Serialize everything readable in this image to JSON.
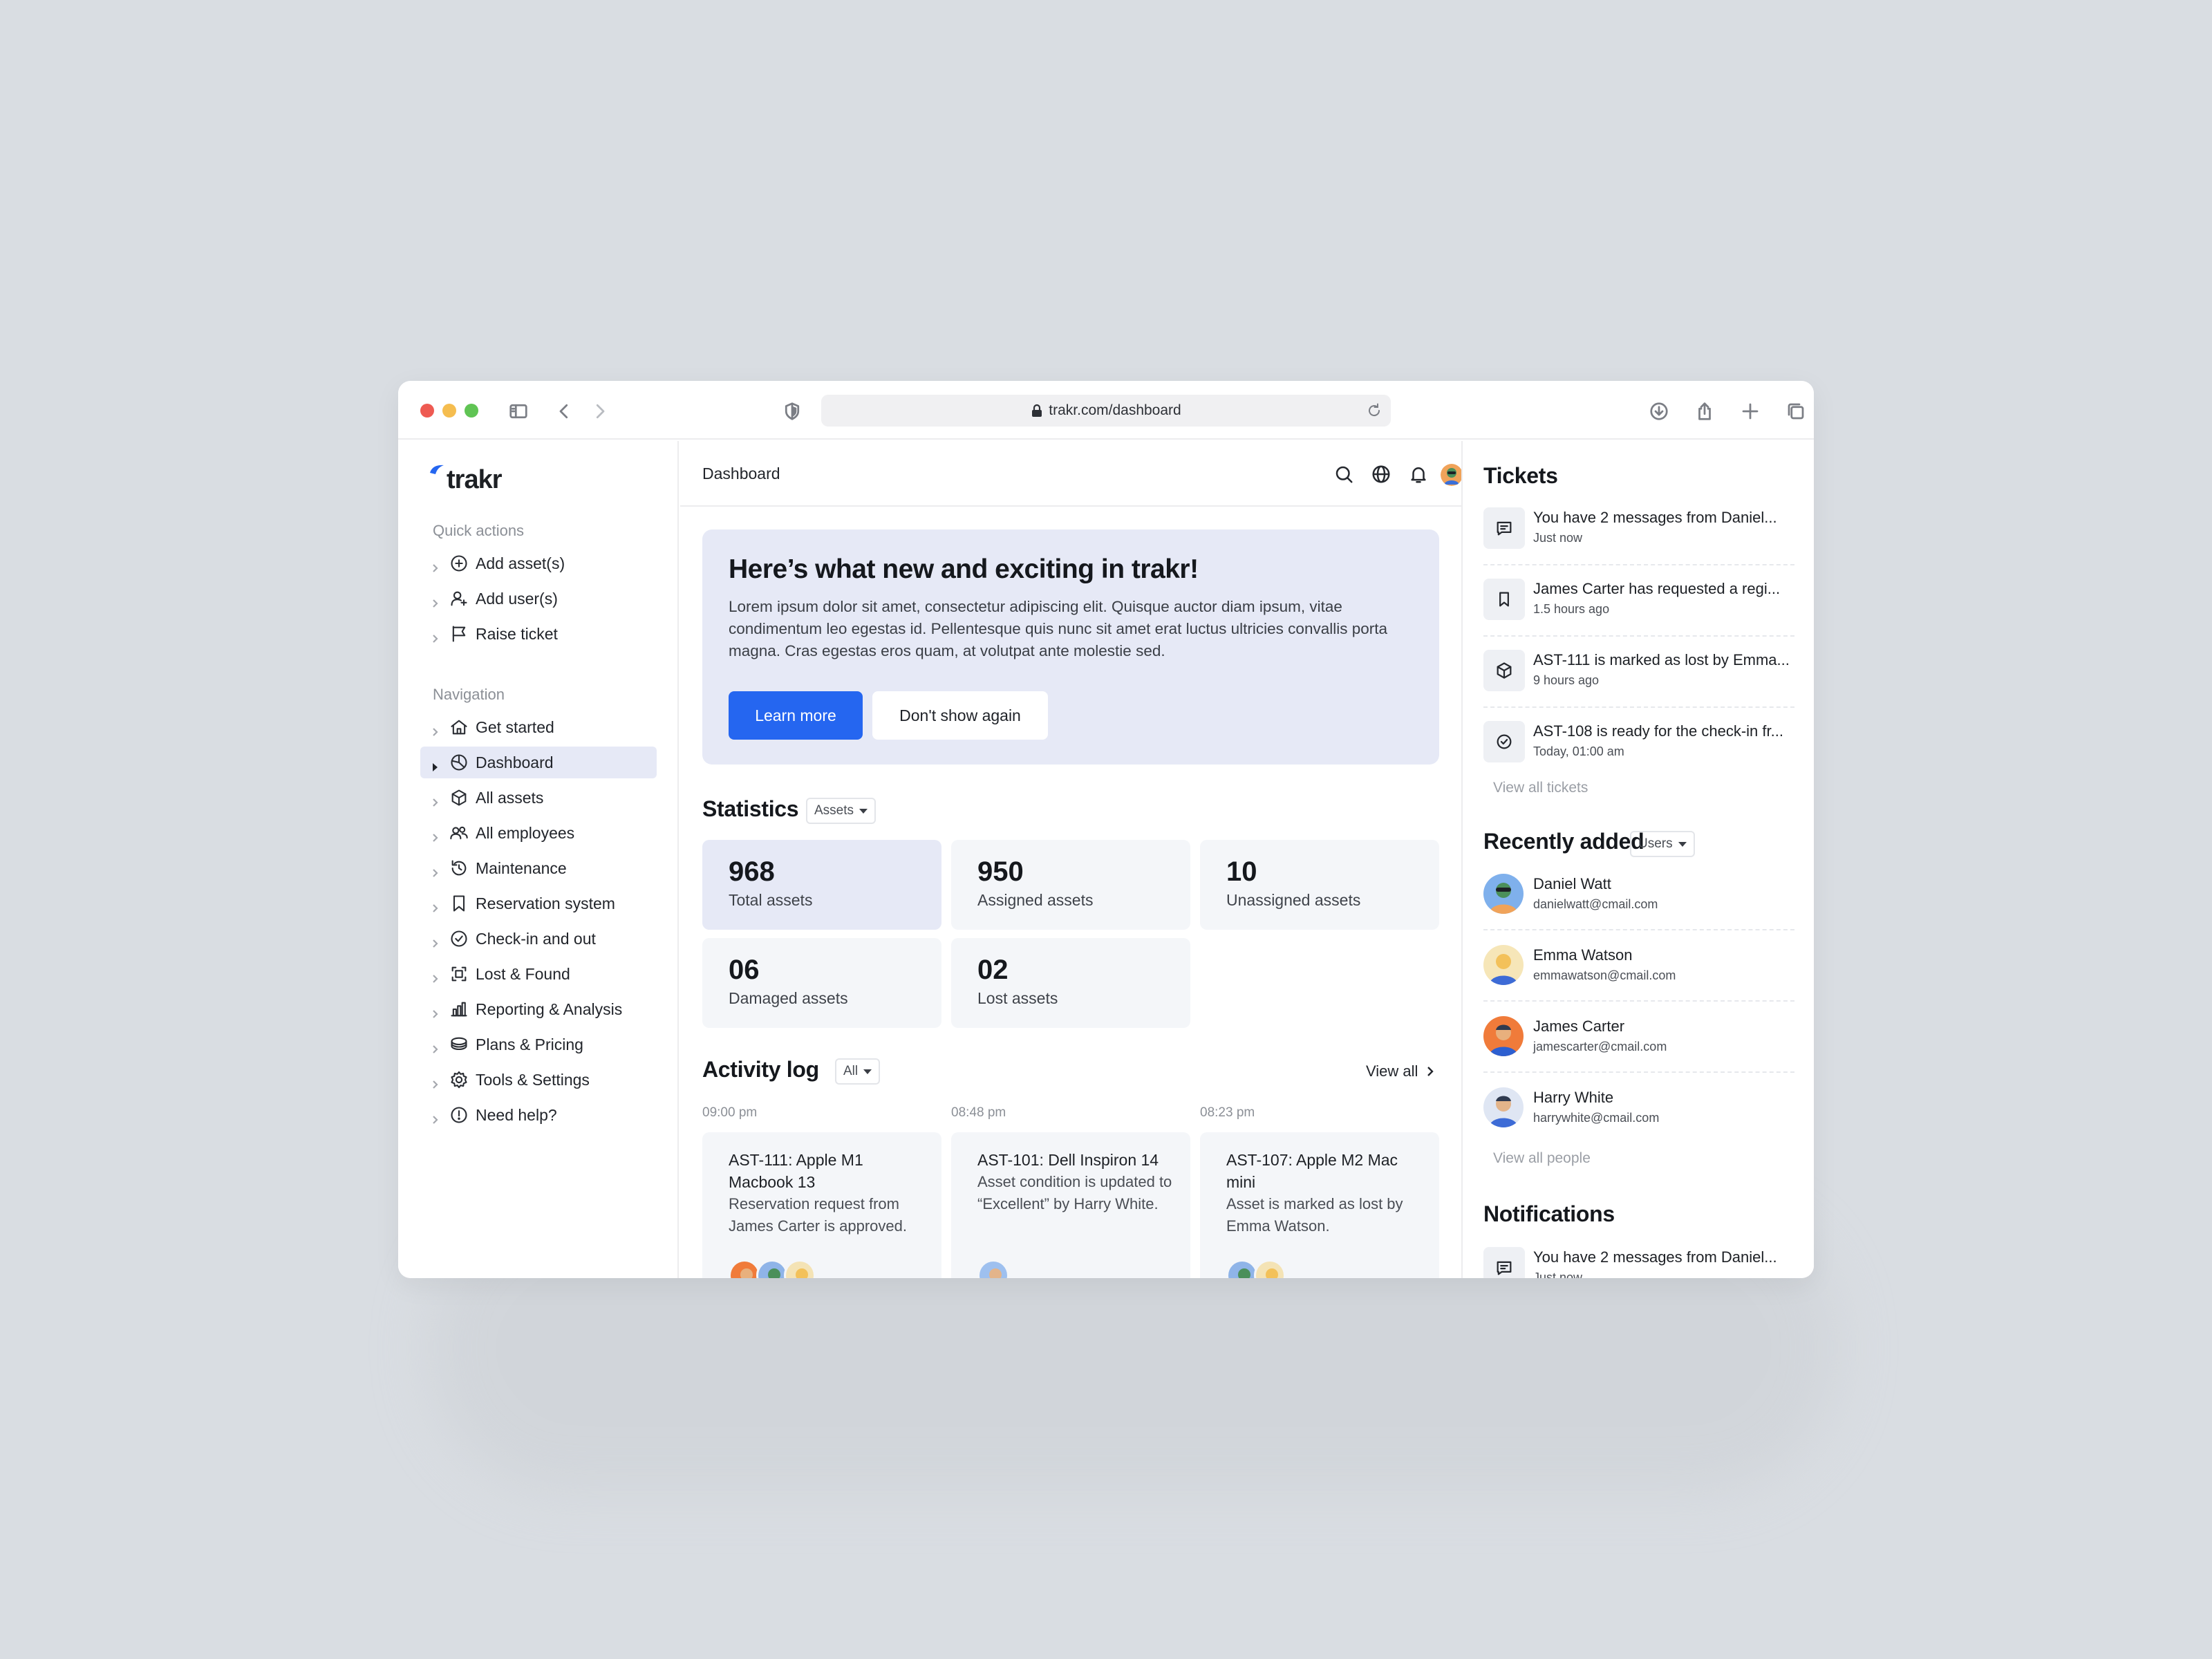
{
  "browser": {
    "url": "trakr.com/dashboard"
  },
  "brand": {
    "name": "trakr",
    "accent": "#2566f0"
  },
  "sidebar": {
    "quick_actions_label": "Quick actions",
    "quick_actions": [
      {
        "label": "Add asset(s)",
        "icon": "plus-circle-icon"
      },
      {
        "label": "Add user(s)",
        "icon": "user-plus-icon"
      },
      {
        "label": "Raise ticket",
        "icon": "flag-icon"
      }
    ],
    "navigation_label": "Navigation",
    "navigation": [
      {
        "label": "Get started",
        "icon": "home-icon"
      },
      {
        "label": "Dashboard",
        "icon": "dashboard-icon",
        "active": true
      },
      {
        "label": "All assets",
        "icon": "box-icon"
      },
      {
        "label": "All employees",
        "icon": "users-icon"
      },
      {
        "label": "Maintenance",
        "icon": "history-icon"
      },
      {
        "label": "Reservation system",
        "icon": "bookmark-icon"
      },
      {
        "label": "Check-in and out",
        "icon": "check-circle-icon"
      },
      {
        "label": "Lost & Found",
        "icon": "scan-icon"
      },
      {
        "label": "Reporting & Analysis",
        "icon": "bar-chart-icon"
      },
      {
        "label": "Plans & Pricing",
        "icon": "coins-icon"
      },
      {
        "label": "Tools & Settings",
        "icon": "gear-icon"
      },
      {
        "label": "Need help?",
        "icon": "alert-circle-icon"
      }
    ]
  },
  "header": {
    "title": "Dashboard"
  },
  "banner": {
    "title": "Here’s what new and exciting in trakr!",
    "body": "Lorem ipsum dolor sit amet, consectetur adipiscing elit. Quisque auctor diam ipsum, vitae condimentum leo egestas id. Pellentesque quis nunc sit amet erat luctus ultricies convallis porta magna. Cras egestas eros quam, at volutpat ante molestie sed.",
    "primary_button": "Learn more",
    "secondary_button": "Don't show again"
  },
  "statistics": {
    "title": "Statistics",
    "filter": "Assets",
    "cards": [
      {
        "value": "968",
        "label": "Total assets"
      },
      {
        "value": "950",
        "label": "Assigned assets"
      },
      {
        "value": "10",
        "label": "Unassigned assets"
      },
      {
        "value": "06",
        "label": "Damaged assets"
      },
      {
        "value": "02",
        "label": "Lost assets"
      }
    ]
  },
  "activity": {
    "title": "Activity log",
    "filter": "All",
    "view_all": "View all",
    "items": [
      {
        "time": "09:00 pm",
        "title": "AST-111: Apple M1 Macbook 13",
        "body": "Reservation request from James Carter is approved."
      },
      {
        "time": "08:48 pm",
        "title": "AST-101: Dell Inspiron 14",
        "body": "Asset condition is updated to “Excellent” by Harry White."
      },
      {
        "time": "08:23 pm",
        "title": "AST-107: Apple M2 Mac mini",
        "body": "Asset is marked as lost by Emma Watson."
      }
    ]
  },
  "tickets": {
    "title": "Tickets",
    "items": [
      {
        "text": "You have 2 messages from Daniel...",
        "time": "Just now",
        "icon": "message-icon"
      },
      {
        "text": "James Carter has requested a regi...",
        "time": "1.5 hours ago",
        "icon": "bookmark-icon"
      },
      {
        "text": "AST-111 is marked as lost by Emma...",
        "time": "9 hours ago",
        "icon": "box-icon"
      },
      {
        "text": "AST-108 is ready for the check-in fr...",
        "time": "Today, 01:00 am",
        "icon": "check-circle-icon"
      }
    ],
    "view_all": "View all tickets"
  },
  "recent": {
    "title": "Recently added",
    "filter": "Users",
    "people": [
      {
        "name": "Daniel Watt",
        "email": "danielwatt@cmail.com"
      },
      {
        "name": "Emma Watson",
        "email": "emmawatson@cmail.com"
      },
      {
        "name": "James Carter",
        "email": "jamescarter@cmail.com"
      },
      {
        "name": "Harry White",
        "email": "harrywhite@cmail.com"
      }
    ],
    "view_all": "View all people"
  },
  "notifications": {
    "title": "Notifications",
    "items": [
      {
        "text": "You have 2 messages from Daniel...",
        "time": "Just now",
        "icon": "message-icon"
      }
    ]
  }
}
